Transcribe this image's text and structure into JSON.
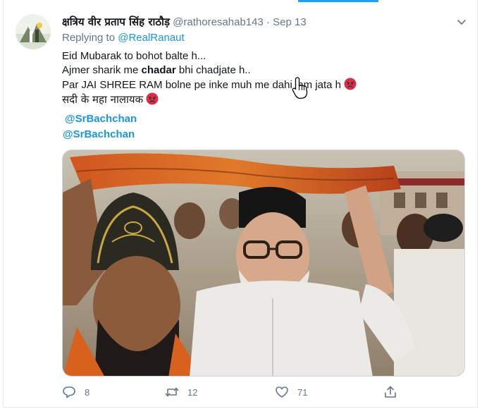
{
  "tweet": {
    "display_name": "क्षत्रिय वीर प्रताप सिंह राठौड़",
    "handle": "@rathoresahab143",
    "separator": "·",
    "date": "Sep 13",
    "replying_prefix": "Replying to",
    "replying_to": "@RealRanaut",
    "lines": {
      "l1": "Eid Mubarak to bohot balte h...",
      "l2_pre": "Ajmer sharik me ",
      "l2_bold": "chadar",
      "l2_post": " bhi chadjate h..",
      "l3": "Par JAI SHREE RAM bolne pe inke muh me dahi jam jata h",
      "l4": "सदी के महा नालायक"
    },
    "emoji": "pouting-face",
    "mentions": [
      "@SrBachchan",
      "@SrBachchan"
    ]
  },
  "actions": {
    "reply_count": "8",
    "retweet_count": "12",
    "like_count": "71"
  },
  "colors": {
    "link": "#1b95e0",
    "muted": "#657786",
    "accent": "#1da1f2"
  }
}
